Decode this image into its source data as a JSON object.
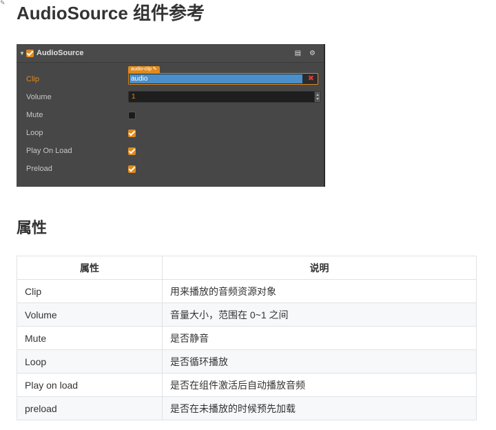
{
  "page": {
    "title": "AudioSource 组件参考",
    "section_title": "属性"
  },
  "inspector": {
    "component_name": "AudioSource",
    "enabled": true,
    "icons": [
      "book-icon",
      "gear-icon"
    ],
    "properties": [
      {
        "label": "Clip",
        "type": "asset",
        "tag": "audio-clip",
        "value": "audio",
        "active": true
      },
      {
        "label": "Volume",
        "type": "number",
        "value": "1"
      },
      {
        "label": "Mute",
        "type": "checkbox",
        "checked": false
      },
      {
        "label": "Loop",
        "type": "checkbox",
        "checked": true
      },
      {
        "label": "Play On Load",
        "type": "checkbox",
        "checked": true
      },
      {
        "label": "Preload",
        "type": "checkbox",
        "checked": true
      }
    ],
    "colors": {
      "accent": "#e08a1e",
      "panel_bg": "#474747",
      "asset_value_bg": "#4a8fc9",
      "remove_red": "#e03a3a"
    }
  },
  "table": {
    "headers": [
      "属性",
      "说明"
    ],
    "rows": [
      [
        "Clip",
        "用来播放的音频资源对象"
      ],
      [
        "Volume",
        "音量大小，范围在 0~1 之间"
      ],
      [
        "Mute",
        "是否静音"
      ],
      [
        "Loop",
        "是否循环播放"
      ],
      [
        "Play on load",
        "是否在组件激活后自动播放音频"
      ],
      [
        "preload",
        "是否在未播放的时候预先加载"
      ]
    ]
  }
}
